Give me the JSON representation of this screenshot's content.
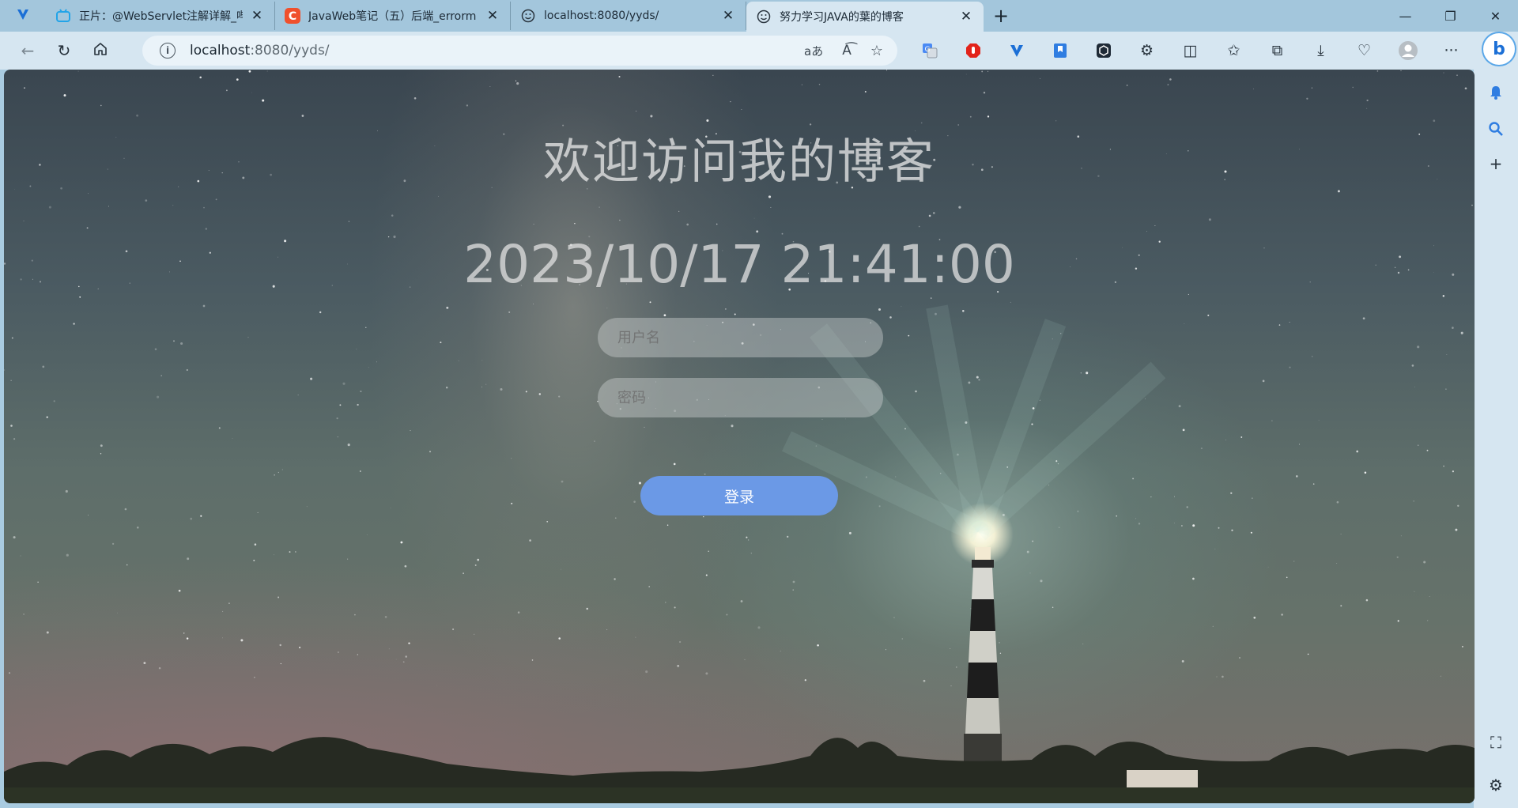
{
  "browser": {
    "tabs": [
      {
        "icon": "tv-icon",
        "title": "正片：@WebServlet注解详解_哔",
        "active": false
      },
      {
        "icon": "c-icon",
        "title": "JavaWeb笔记（五）后端_errorm",
        "active": false
      },
      {
        "icon": "smiley-icon",
        "title": "localhost:8080/yyds/",
        "active": false
      },
      {
        "icon": "smiley-icon",
        "title": "努力学习JAVA的葉的博客",
        "active": true
      }
    ],
    "address": {
      "host": "localhost",
      "path": ":8080/yyds/"
    }
  },
  "page": {
    "title": "欢迎访问我的博客",
    "clock": "2023/10/17 21:41:00",
    "username_placeholder": "用户名",
    "password_placeholder": "密码",
    "login_label": "登录"
  },
  "colors": {
    "login_button": "#6b99e6",
    "tabstrip": "#a3c6dc",
    "toolbar": "#d6e6f1"
  }
}
